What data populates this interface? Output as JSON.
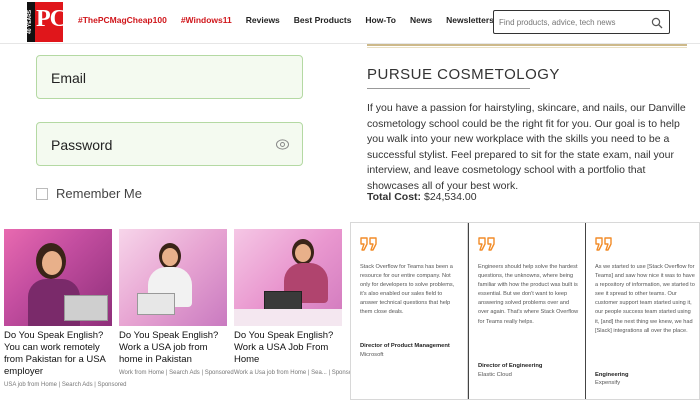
{
  "header": {
    "logo": {
      "badge": "40 YEARS",
      "text": "PC"
    },
    "nav": [
      {
        "label": "#ThePCMagCheap100",
        "hot": true
      },
      {
        "label": "#Windows11",
        "hot": true
      },
      {
        "label": "Reviews",
        "hot": false
      },
      {
        "label": "Best Products",
        "hot": false
      },
      {
        "label": "How-To",
        "hot": false
      },
      {
        "label": "News",
        "hot": false
      },
      {
        "label": "Newsletters",
        "hot": false
      }
    ],
    "search": {
      "placeholder": "Find products, advice, tech news"
    }
  },
  "login": {
    "email_label": "Email",
    "password_label": "Password",
    "remember_label": "Remember Me"
  },
  "ads": [
    {
      "title": "Do You Speak English? You can work remotely from Pakistan for a USA employer",
      "meta": "USA job from Home | Search Ads | Sponsored"
    },
    {
      "title": "Do You Speak English? Work a USA job from home in Pakistan",
      "meta": "Work from Home | Search Ads | Sponsored"
    },
    {
      "title": "Do You Speak English? Work a USA Job From Home",
      "meta": "Work a Usa job from Home | Sea... | Sponsored"
    }
  ],
  "cosmetology": {
    "title": "PURSUE COSMETOLOGY",
    "body": "If you have a passion for hairstyling, skincare, and nails, our Danville cosmetology school could be the right fit for you. Our goal is to help you walk into your new workplace with the skills you need to be a successful stylist. Feel prepared to sit for the state exam, nail your interview, and leave cosmetology school with a portfolio that showcases all of your best work.",
    "total_label": "Total Cost:",
    "total_value": "$24,534.00"
  },
  "testimonials": [
    {
      "text": "Stack Overflow for Teams has been a resource for our entire company. Not only for developers to solve problems, it's also enabled our sales field to answer technical questions that help them close deals.",
      "role": "Director of Product Management",
      "company": "Microsoft"
    },
    {
      "text": "Engineers should help solve the hardest questions, the unknowns, where being familiar with how the product was built is essential. But we don't want to keep answering solved problems over and over again. That's where Stack Overflow for Teams really helps.",
      "role": "Director of Engineering",
      "company": "Elastic Cloud"
    },
    {
      "text": "As we started to use [Stack Overflow for Teams] and saw how nice it was to have a repository of information, we started to see it spread to other teams. Our customer support team started using it, our people success team started using it, [and] the next thing we knew, we had [Slack] integrations all over the place.",
      "role": "Engineering",
      "company": "Expensify"
    }
  ],
  "colors": {
    "brand_red": "#e0161b",
    "field_green": "#f4faf0",
    "field_border": "#b4d9a3",
    "quote_orange": "#f28c28"
  },
  "icons": [
    "search-icon",
    "eye-icon",
    "quote-icon"
  ]
}
